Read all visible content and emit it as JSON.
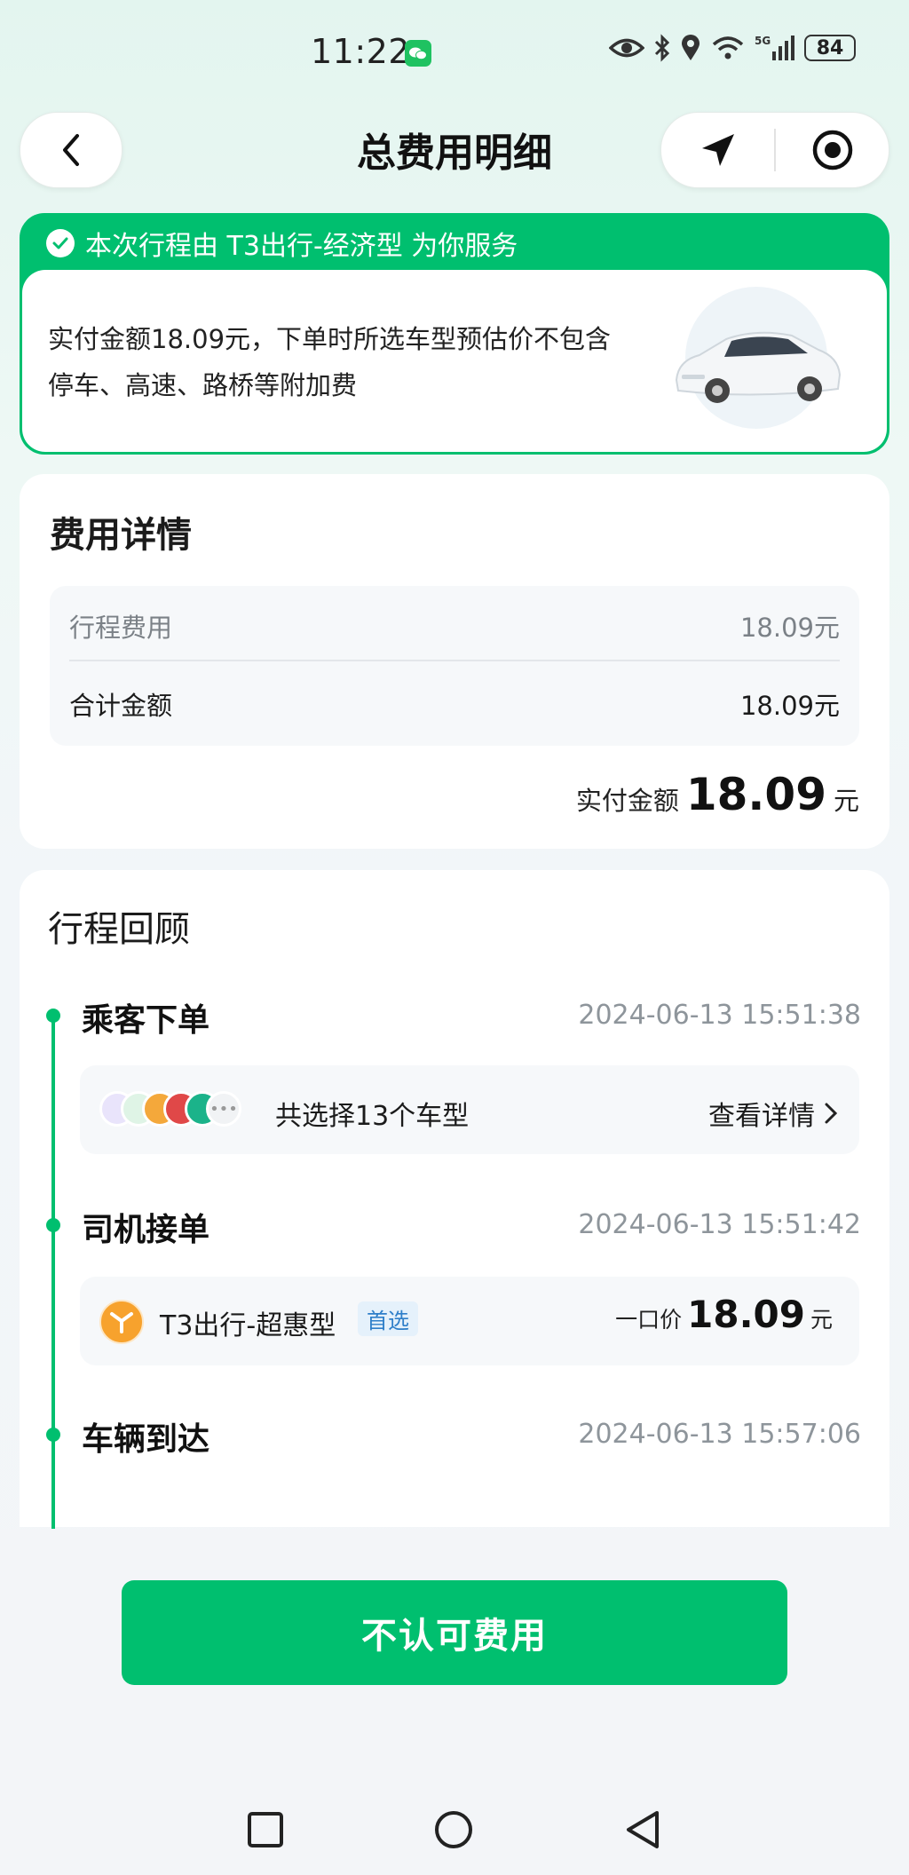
{
  "status": {
    "time": "11:22",
    "battery": "84"
  },
  "header": {
    "title": "总费用明细"
  },
  "banner": {
    "service_text": "本次行程由 T3出行-经济型 为你服务",
    "note": "实付金额18.09元，下单时所选车型预估价不包含停车、高速、路桥等附加费"
  },
  "fee": {
    "title": "费用详情",
    "rows": [
      {
        "label": "行程费用",
        "value": "18.09元"
      },
      {
        "label": "合计金额",
        "value": "18.09元"
      }
    ],
    "paid_label": "实付金额",
    "paid_amount": "18.09",
    "paid_unit": "元"
  },
  "review": {
    "title": "行程回顾",
    "steps": [
      {
        "label": "乘客下单",
        "time": "2024-06-13 15:51:38"
      },
      {
        "label": "司机接单",
        "time": "2024-06-13 15:51:42"
      },
      {
        "label": "车辆到达",
        "time": "2024-06-13 15:57:06"
      }
    ],
    "order_summary": "共选择13个车型",
    "view_details": "查看详情",
    "vehicle": "T3出行-超惠型",
    "vehicle_tag": "首选",
    "price_label": "一口价",
    "price": "18.09",
    "price_unit": "元"
  },
  "actions": {
    "dispute": "不认可费用"
  },
  "colors": {
    "brand_green": "#00bf6f",
    "muted": "#8e959b"
  }
}
